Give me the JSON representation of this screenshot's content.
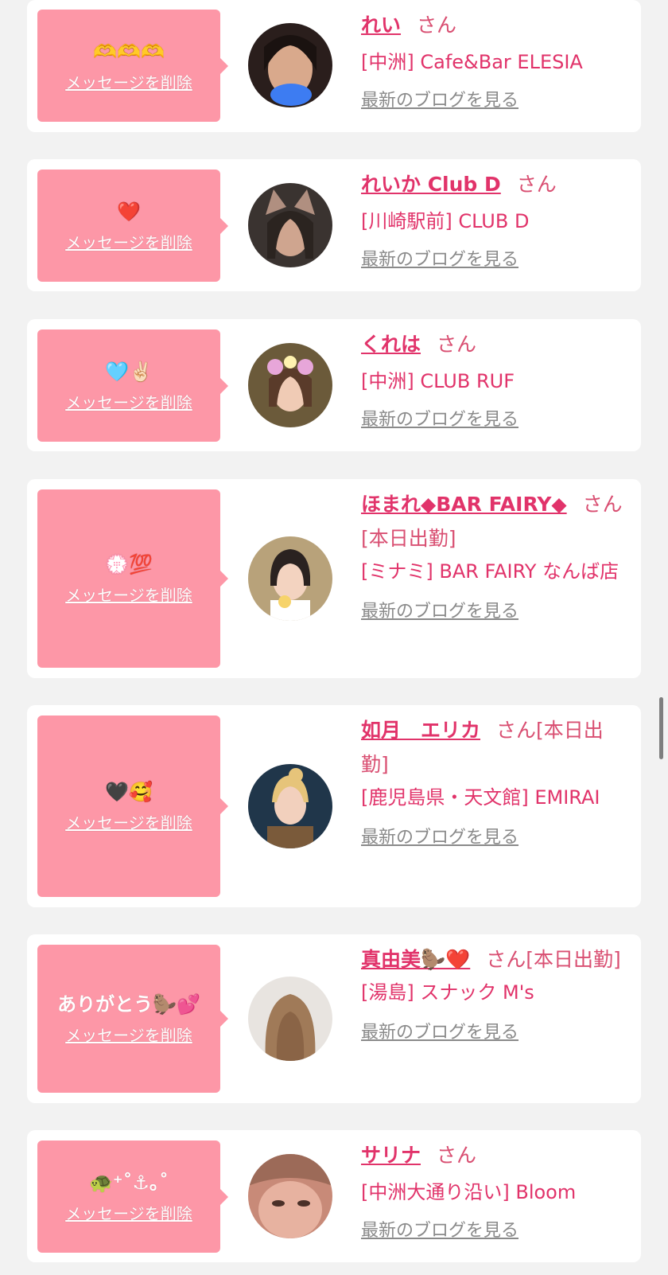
{
  "messages": [
    {
      "message": "🫶🫶🫶",
      "delete_label": "メッセージを削除",
      "name": "れい",
      "suffix": "さん",
      "shop": "[中洲] Cafe&Bar ELESIA",
      "blog_link": "最新のブログを見る"
    },
    {
      "message": "❤️",
      "delete_label": "メッセージを削除",
      "name": "れいか Club D",
      "suffix": "さん",
      "shop": "[川崎駅前] CLUB D",
      "blog_link": "最新のブログを見る"
    },
    {
      "message": "🩵✌🏻",
      "delete_label": "メッセージを削除",
      "name": "くれは",
      "suffix": "さん",
      "shop": "[中洲] CLUB RUF",
      "blog_link": "最新のブログを見る"
    },
    {
      "message": "💮💯",
      "delete_label": "メッセージを削除",
      "name": "ほまれ◆BAR FAIRY◆",
      "suffix": "さん[本日出勤]",
      "shop": "[ミナミ] BAR FAIRY なんば店",
      "blog_link": "最新のブログを見る"
    },
    {
      "message": "🖤🥰",
      "delete_label": "メッセージを削除",
      "name": "如月　エリカ",
      "suffix": "さん[本日出勤]",
      "shop": "[鹿児島県・天文館] EMIRAI",
      "blog_link": "最新のブログを見る"
    },
    {
      "message": "ありがとう🦫💕",
      "delete_label": "メッセージを削除",
      "name": "真由美🦫❤️",
      "suffix": "さん[本日出勤]",
      "shop": "[湯島] スナック M's",
      "blog_link": "最新のブログを見る"
    },
    {
      "message": "🐢⁺˚⚓︎｡˚",
      "delete_label": "メッセージを削除",
      "name": "サリナ",
      "suffix": "さん",
      "shop": "[中洲大通り沿い] Bloom",
      "blog_link": "最新のブログを見る"
    }
  ]
}
